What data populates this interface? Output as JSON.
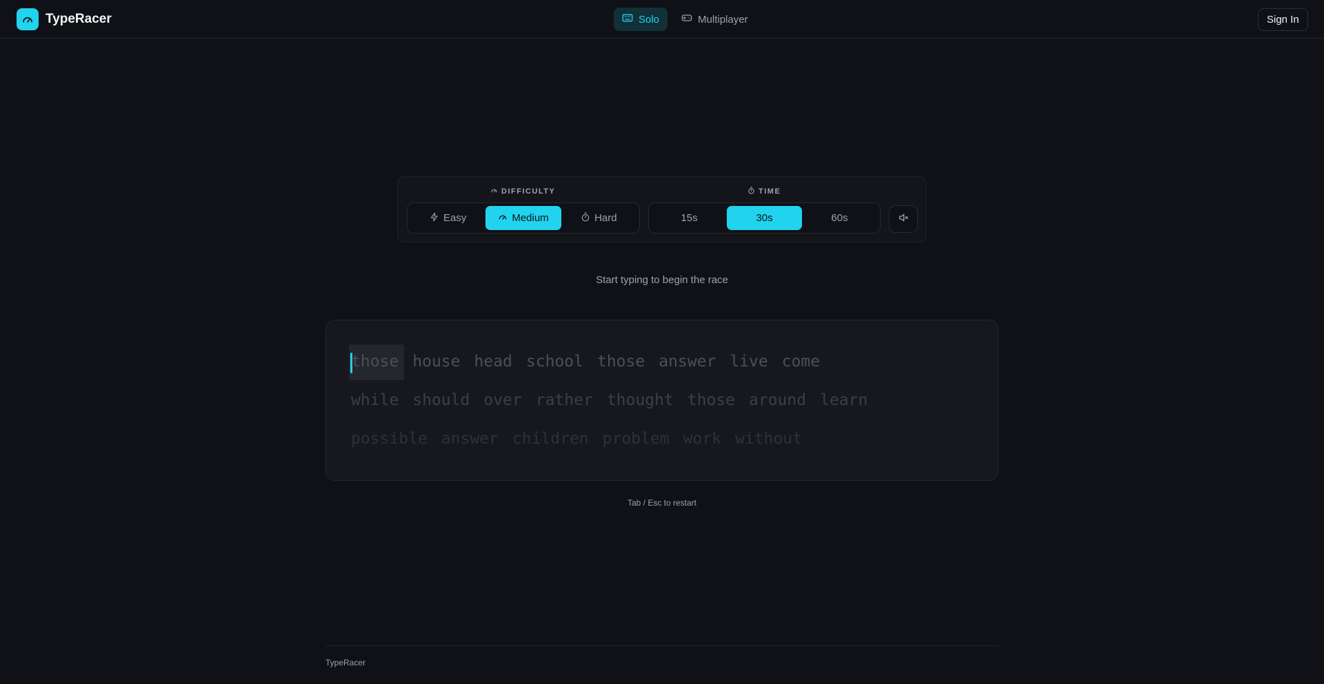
{
  "header": {
    "brand_name": "TypeRacer",
    "nav": [
      {
        "label": "Solo",
        "icon": "keyboard-icon",
        "active": true
      },
      {
        "label": "Multiplayer",
        "icon": "gamepad-icon",
        "active": false
      }
    ],
    "signin_label": "Sign In"
  },
  "settings": {
    "difficulty_title": "DIFFICULTY",
    "difficulty": [
      {
        "label": "Easy",
        "icon": "bolt-icon"
      },
      {
        "label": "Medium",
        "icon": "gauge-icon"
      },
      {
        "label": "Hard",
        "icon": "timer-icon"
      }
    ],
    "difficulty_selected": "Medium",
    "time_title": "TIME",
    "time": [
      {
        "label": "15s"
      },
      {
        "label": "30s"
      },
      {
        "label": "60s"
      }
    ],
    "time_selected": "30s",
    "mute_icon": "speaker-muted-icon"
  },
  "hint": "Start typing to begin the race",
  "words": {
    "line1": [
      "those",
      "house",
      "head",
      "school",
      "those",
      "answer",
      "live",
      "come"
    ],
    "line2": [
      "while",
      "should",
      "over",
      "rather",
      "thought",
      "those",
      "around",
      "learn"
    ],
    "line3": [
      "possible",
      "answer",
      "children",
      "problem",
      "work",
      "without"
    ]
  },
  "restart_hint": "Tab / Esc to restart",
  "footer": {
    "text": "TypeRacer"
  },
  "colors": {
    "accent": "#22d3ee",
    "background": "#0f1116"
  }
}
